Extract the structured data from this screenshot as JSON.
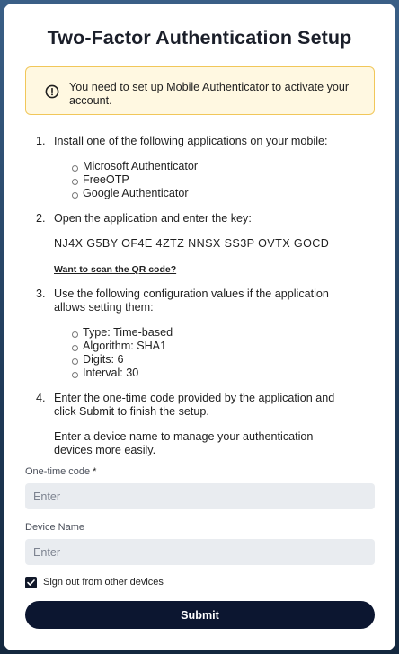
{
  "page": {
    "title": "Two-Factor Authentication Setup"
  },
  "alert": {
    "icon": "exclamation-circle-icon",
    "message": "You need to set up Mobile Authenticator to activate your account."
  },
  "steps": [
    {
      "number": "1.",
      "text": "Install one of the following applications on your mobile:",
      "apps": [
        "Microsoft Authenticator",
        "FreeOTP",
        "Google Authenticator"
      ]
    },
    {
      "number": "2.",
      "text": "Open the application and enter the key:",
      "key": "NJ4X G5BY OF4E 4ZTZ NNSX SS3P OVTX GOCD",
      "qr_link": "Want to scan the QR code?"
    },
    {
      "number": "3.",
      "text": "Use the following configuration values if the application allows setting them:",
      "config": [
        "Type: Time-based",
        "Algorithm: SHA1",
        "Digits: 6",
        "Interval: 30"
      ]
    },
    {
      "number": "4.",
      "text": "Enter the one-time code provided by the application and click Submit to finish the setup.",
      "note": "Enter a device name to manage your authentication devices more easily."
    }
  ],
  "form": {
    "otp_label": "One-time code",
    "otp_required_marker": "*",
    "otp_placeholder": "Enter",
    "otp_value": "",
    "device_label": "Device Name",
    "device_placeholder": "Enter",
    "device_value": "",
    "signout_label": "Sign out from other devices",
    "signout_checked": true,
    "submit_label": "Submit"
  },
  "colors": {
    "alert_bg": "#fff8e1",
    "alert_border": "#f1c75a",
    "submit_bg": "#0c1630",
    "input_bg": "#e9ecf0"
  }
}
